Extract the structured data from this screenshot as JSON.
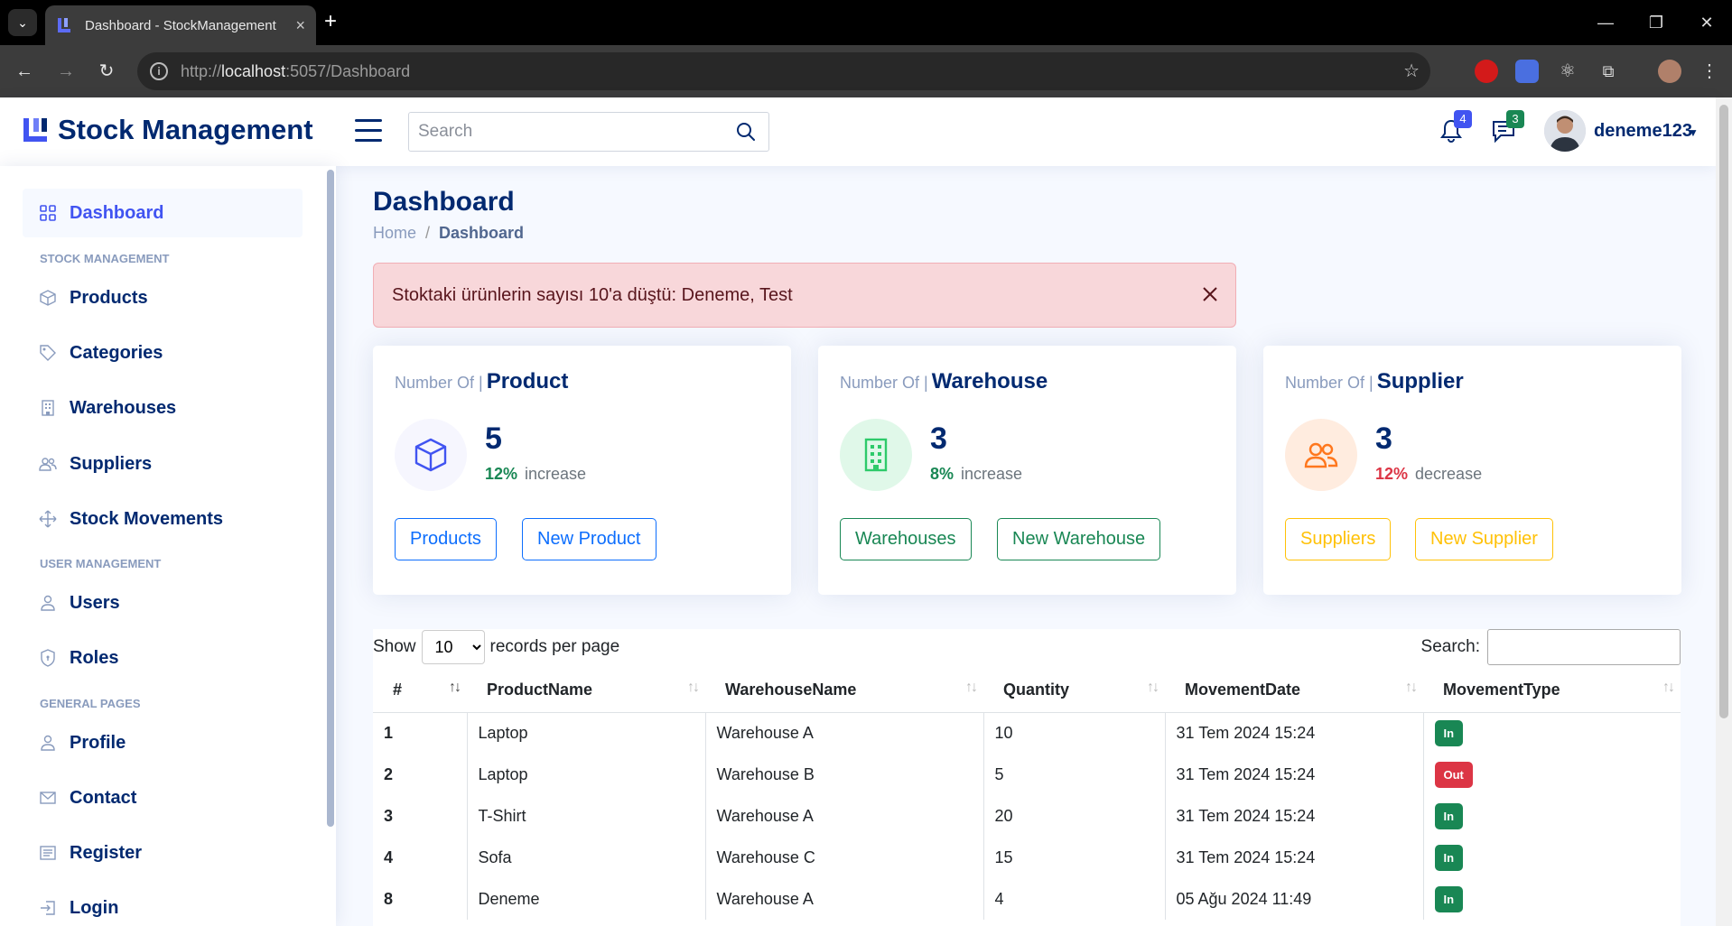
{
  "browser": {
    "tab_title": "Dashboard - StockManagement",
    "url_prefix": "http://",
    "url_host": "localhost",
    "url_path": ":5057/Dashboard",
    "new_tab": "+",
    "close_tab": "×"
  },
  "header": {
    "brand": "Stock Management",
    "search_placeholder": "Search",
    "notifications_count": "4",
    "messages_count": "3",
    "user_name": "deneme123"
  },
  "sidebar": {
    "dashboard": "Dashboard",
    "heading_stock": "STOCK MANAGEMENT",
    "products": "Products",
    "categories": "Categories",
    "warehouses": "Warehouses",
    "suppliers": "Suppliers",
    "stock_movements": "Stock Movements",
    "heading_user": "USER MANAGEMENT",
    "users": "Users",
    "roles": "Roles",
    "heading_general": "GENERAL PAGES",
    "profile": "Profile",
    "contact": "Contact",
    "register": "Register",
    "login": "Login"
  },
  "page": {
    "title": "Dashboard",
    "breadcrumb_home": "Home",
    "breadcrumb_sep": "/",
    "breadcrumb_current": "Dashboard"
  },
  "alert": {
    "message": "Stoktaki ürünlerin sayısı 10'a düştü: Deneme, Test"
  },
  "cards": {
    "product": {
      "prefix": "Number Of |",
      "title": "Product",
      "value": "5",
      "pct": "12%",
      "word": "increase",
      "btn_list": "Products",
      "btn_new": "New Product"
    },
    "warehouse": {
      "prefix": "Number Of |",
      "title": "Warehouse",
      "value": "3",
      "pct": "8%",
      "word": "increase",
      "btn_list": "Warehouses",
      "btn_new": "New Warehouse"
    },
    "supplier": {
      "prefix": "Number Of |",
      "title": "Supplier",
      "value": "3",
      "pct": "12%",
      "word": "decrease",
      "btn_list": "Suppliers",
      "btn_new": "New Supplier"
    }
  },
  "table": {
    "show_label": "Show",
    "page_size": "10",
    "records_label": "records per page",
    "search_label": "Search:",
    "columns": [
      "#",
      "ProductName",
      "WarehouseName",
      "Quantity",
      "MovementDate",
      "MovementType"
    ],
    "rows": [
      [
        "1",
        "Laptop",
        "Warehouse A",
        "10",
        "31 Tem 2024 15:24",
        "In"
      ],
      [
        "2",
        "Laptop",
        "Warehouse B",
        "5",
        "31 Tem 2024 15:24",
        "Out"
      ],
      [
        "3",
        "T-Shirt",
        "Warehouse A",
        "20",
        "31 Tem 2024 15:24",
        "In"
      ],
      [
        "4",
        "Sofa",
        "Warehouse C",
        "15",
        "31 Tem 2024 15:24",
        "In"
      ],
      [
        "8",
        "Deneme",
        "Warehouse A",
        "4",
        "05 Ağu 2024 11:49",
        "In"
      ]
    ]
  },
  "colors": {
    "brand": "#012970",
    "accent": "#4154f1",
    "success": "#198754",
    "danger": "#dc3545",
    "warning": "#ffc107"
  }
}
